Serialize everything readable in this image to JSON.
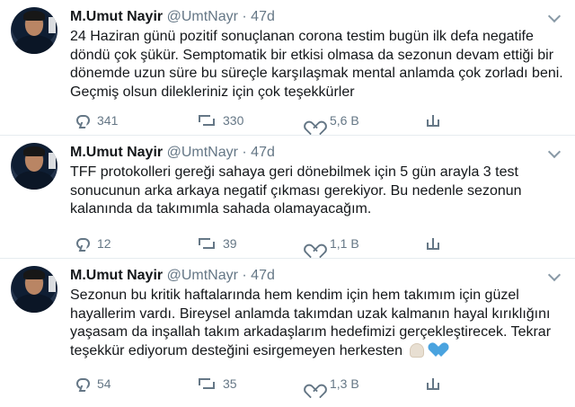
{
  "tweets": [
    {
      "name": "M.Umut Nayir",
      "handle": "@UmtNayr",
      "dot": "·",
      "time": "47d",
      "text_lines": [
        "24 Haziran günü pozitif sonuçlanan corona testim bugün ilk defa negatife",
        "döndü çok şükür. Semptomatik bir etkisi olmasa da sezonun devam ettiği bir",
        "dönemde uzun süre bu süreçle karşılaşmak mental anlamda çok zorladı beni.",
        "Geçmiş olsun dilekleriniz için çok teşekkürler"
      ],
      "replies": "341",
      "retweets": "330",
      "likes": "5,6 B"
    },
    {
      "name": "M.Umut Nayir",
      "handle": "@UmtNayr",
      "dot": "·",
      "time": "47d",
      "text_lines": [
        "TFF protokolleri gereği sahaya geri dönebilmek için 5 gün arayla 3 test",
        "sonucunun arka arkaya negatif çıkması gerekiyor. Bu nedenle sezonun",
        "kalanında da takımımla sahada olamayacağım."
      ],
      "replies": "12",
      "retweets": "39",
      "likes": "1,1 B"
    },
    {
      "name": "M.Umut Nayir",
      "handle": "@UmtNayr",
      "dot": "·",
      "time": "47d",
      "text_lines": [
        "Sezonun bu kritik haftalarında hem kendim için hem takımım için güzel",
        "hayallerim vardı. Bireysel anlamda takımdan uzak kalmanın hayal kırıklığını",
        "yaşasam da inşallah takım arkadaşlarım hedefimizi gerçekleştirecek. Tekrar",
        "teşekkür ediyorum desteğini esirgemeyen herkesten"
      ],
      "emoji_icons": [
        "folded-hands-icon",
        "blue-heart-icon"
      ],
      "replies": "54",
      "retweets": "35",
      "likes": "1,3 B"
    }
  ],
  "colors": {
    "text": "#14171a",
    "secondary": "#657786",
    "border": "#e6ecf0",
    "blue_heart": "#4aa3df"
  }
}
